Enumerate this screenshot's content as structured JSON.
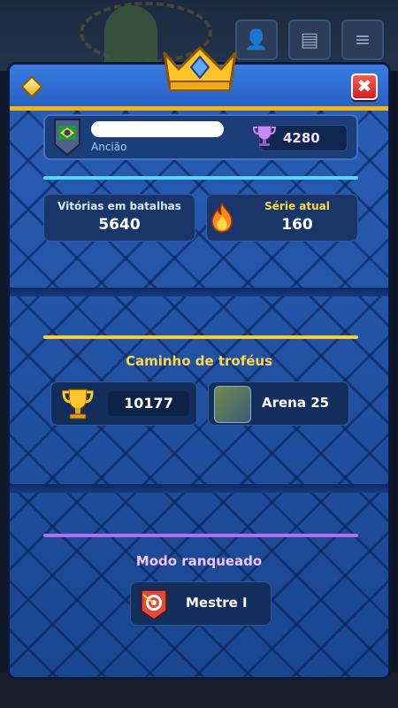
{
  "header": {
    "close_label": "✖"
  },
  "profile": {
    "role": "Ancião",
    "trophies": "4280"
  },
  "stats": {
    "wins_label": "Vitórias em batalhas",
    "wins_value": "5640",
    "streak_label": "Série atual",
    "streak_value": "160"
  },
  "trophy_road": {
    "title": "Caminho de troféus",
    "trophies": "10177",
    "arena": "Arena 25"
  },
  "ranked": {
    "title": "Modo ranqueado",
    "league": "Mestre I"
  },
  "colors": {
    "panel": "#1d4d9c",
    "header": "#2761c5",
    "gold": "#f2b321",
    "cyan_divider": "#57d7ff",
    "yellow_divider": "#ffcc2c",
    "purple_divider": "#b56cf0"
  },
  "icons": [
    "crown-icon",
    "gem-icon",
    "close-icon",
    "clan-badge-icon",
    "purple-trophy-icon",
    "flame-icon",
    "gold-trophy-icon",
    "arena-icon",
    "ranked-target-icon"
  ]
}
